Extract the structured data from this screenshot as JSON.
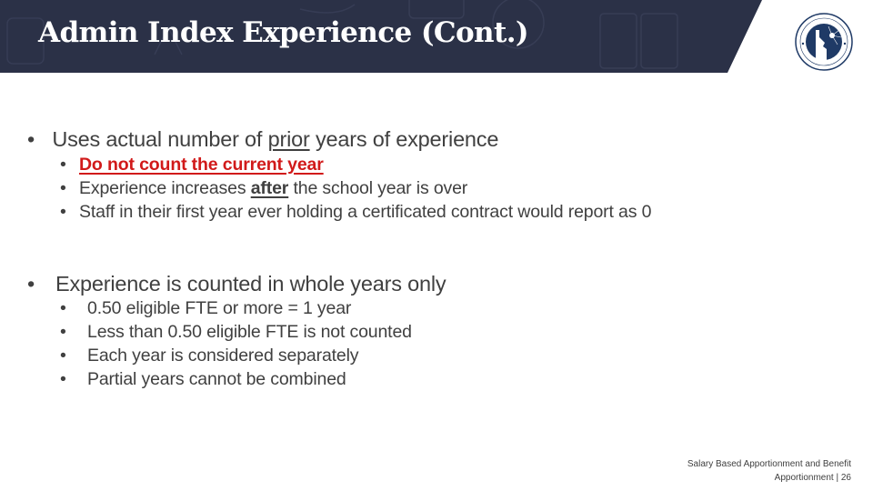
{
  "header": {
    "title": "Admin Index Experience (Cont.)",
    "band_color": "#2b3147",
    "logo": {
      "name": "idaho-department-of-education-seal",
      "top_text": "DEPARTMENT OF EDUCATION",
      "bottom_text": "STATE OF IDAHO"
    }
  },
  "sections": [
    {
      "bullet": "•",
      "text_before": "Uses actual number of ",
      "emphasis": "prior",
      "text_after": " years of experience",
      "items": [
        {
          "bullet": "•",
          "text": "Do not count the current year",
          "style": "red-bold-underline",
          "color": "#d11a1a"
        },
        {
          "bullet": "•",
          "text_before": "Experience increases ",
          "emphasis": "after",
          "text_after": " the school year is over"
        },
        {
          "bullet": "•",
          "text": "Staff in their first year ever holding a certificated contract would report as 0"
        }
      ]
    },
    {
      "bullet": "•",
      "text": "Experience is counted in whole years only",
      "items": [
        {
          "bullet": "•",
          "text": "0.50 eligible FTE or more = 1 year"
        },
        {
          "bullet": "•",
          "text": "Less than 0.50 eligible FTE is not counted"
        },
        {
          "bullet": "•",
          "text": "Each year is considered separately"
        },
        {
          "bullet": "•",
          "text": "Partial years cannot be combined"
        }
      ]
    }
  ],
  "footer": {
    "line1": "Salary Based Apportionment and Benefit",
    "line2": "Apportionment | 26"
  }
}
